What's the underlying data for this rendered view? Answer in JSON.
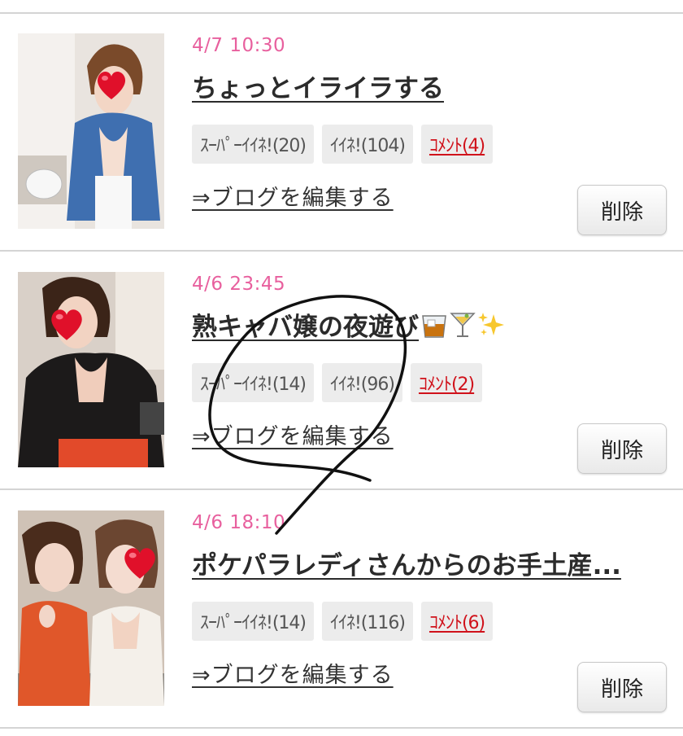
{
  "entries": [
    {
      "date": "4/7 10:30",
      "title": "ちょっとイライラする",
      "super_like": "ｽｰﾊﾟｰｲｲﾈ!(20)",
      "like": "ｲｲﾈ!(104)",
      "comment": "ｺﾒﾝﾄ(4)",
      "edit_link": "⇒ブログを編集する",
      "delete_label": "削除"
    },
    {
      "date": "4/6 23:45",
      "title": "熟キャバ嬢の夜遊び",
      "title_emoji": [
        "whisky-glass",
        "cocktail-glass",
        "sparkles"
      ],
      "super_like": "ｽｰﾊﾟｰｲｲﾈ!(14)",
      "like": "ｲｲﾈ!(96)",
      "comment": "ｺﾒﾝﾄ(2)",
      "edit_link": "⇒ブログを編集する",
      "delete_label": "削除"
    },
    {
      "date": "4/6 18:10",
      "title": "ポケパラレディさんからのお手土産...",
      "super_like": "ｽｰﾊﾟｰｲｲﾈ!(14)",
      "like": "ｲｲﾈ!(116)",
      "comment": "ｺﾒﾝﾄ(6)",
      "edit_link": "⇒ブログを編集する",
      "delete_label": "削除"
    }
  ],
  "colors": {
    "date": "#e8609e",
    "comment": "#d0121b",
    "heart": "#e0102a"
  }
}
